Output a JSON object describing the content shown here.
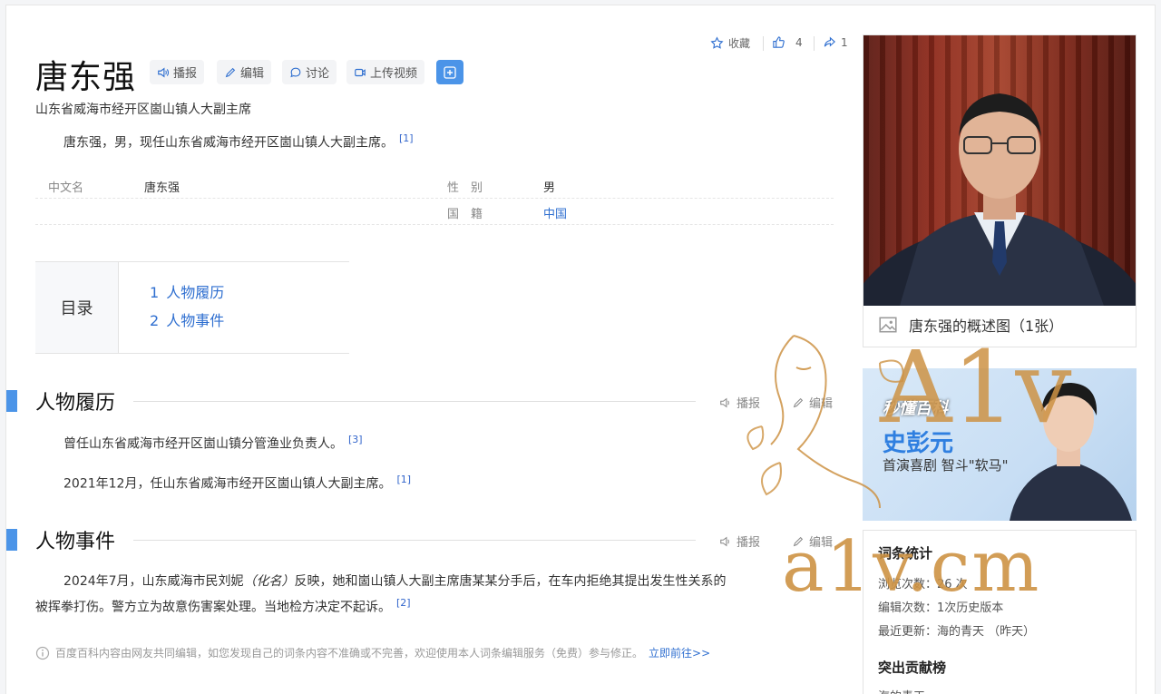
{
  "entry": {
    "title": "唐东强",
    "subtitle": "山东省威海市经开区崮山镇人大副主席",
    "summary": "唐东强，男，现任山东省威海市经开区崮山镇人大副主席。",
    "summary_ref": "[1]"
  },
  "title_buttons": {
    "broadcast": "播报",
    "edit": "编辑",
    "discuss": "讨论",
    "upload_video": "上传视频"
  },
  "top_actions": {
    "collect_label": "收藏",
    "like_count": "4",
    "share_count": "1"
  },
  "infobox": {
    "rows": [
      {
        "label": "中文名",
        "value": "唐东强"
      },
      {
        "label": "性　别",
        "value": "男"
      },
      {
        "label": "国　籍",
        "value": "中国"
      }
    ]
  },
  "toc": {
    "label": "目录",
    "items": [
      {
        "num": "1",
        "label": "人物履历"
      },
      {
        "num": "2",
        "label": "人物事件"
      }
    ]
  },
  "sections": [
    {
      "title": "人物履历",
      "broadcast": "播报",
      "edit": "编辑",
      "paragraphs": [
        {
          "text": "曾任山东省威海市经开区崮山镇分管渔业负责人。",
          "ref": "[3]"
        },
        {
          "text": "2021年12月，任山东省威海市经开区崮山镇人大副主席。",
          "ref": "[1]"
        }
      ]
    },
    {
      "title": "人物事件",
      "broadcast": "播报",
      "edit": "编辑",
      "paragraphs": [
        {
          "text_before": "2024年7月，山东威海市民刘妮",
          "text_italic": "（化名）",
          "text_after": "反映，她和崮山镇人大副主席唐某某分手后，在车内拒绝其提出发生性关系的",
          "line2": "被挥拳打伤。警方立为故意伤害案处理。当地检方决定不起诉。",
          "ref": "[2]"
        }
      ]
    }
  ],
  "footnote": {
    "text": "百度百科内容由网友共同编辑，如您发现自己的词条内容不准确或不完善，欢迎使用本人词条编辑服务（免费）参与修正。",
    "link": "立即前往>>"
  },
  "image_card": {
    "caption": "唐东强的概述图（1张）"
  },
  "ad": {
    "brand": "秒懂百科",
    "name": "史彭元",
    "desc": "首演喜剧 智斗\"软马\""
  },
  "stats": {
    "title": "词条统计",
    "views": "浏览次数：26 次",
    "edits": "编辑次数：1次历史版本",
    "last_update": "最近更新：海的青天 （昨天）",
    "contrib_title": "突出贡献榜",
    "contrib_first": "海的青天"
  },
  "watermark": {
    "text": "a1v.cm",
    "logo": "A1v"
  },
  "colors": {
    "accent": "#4b94e8",
    "link": "#2f6fd0",
    "watermark": "#cd9244"
  }
}
